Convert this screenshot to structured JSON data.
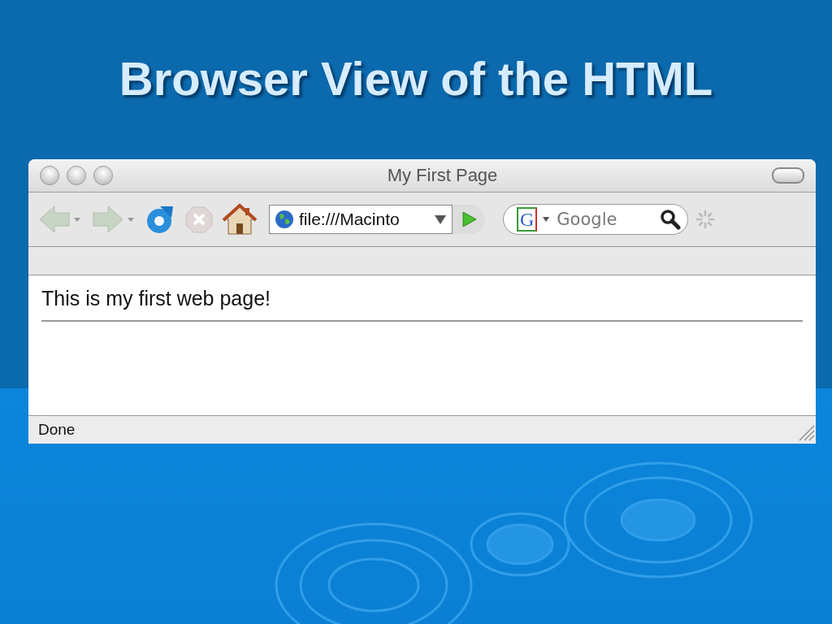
{
  "slide_title": "Browser View of the HTML",
  "window": {
    "title": "My First Page"
  },
  "toolbar": {
    "back": {
      "disabled": true
    },
    "forward": {
      "disabled": true
    },
    "stop": {
      "disabled": true
    },
    "address": {
      "value": "file:///Macinto"
    },
    "search": {
      "engine_logo": "G",
      "placeholder": "Google"
    }
  },
  "page": {
    "text": "This is my first web page!"
  },
  "status_bar": {
    "text": "Done"
  }
}
